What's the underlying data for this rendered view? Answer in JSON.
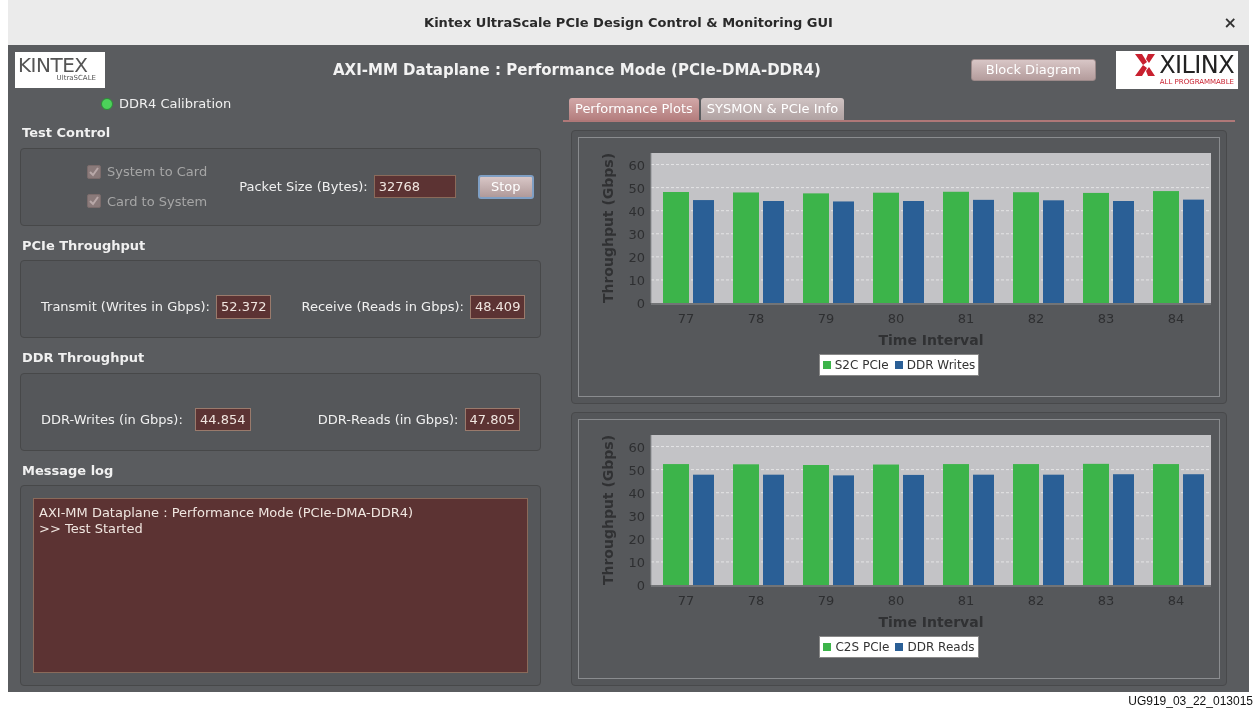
{
  "window": {
    "title": "Kintex UltraScale PCIe Design Control & Monitoring GUI",
    "close": "×"
  },
  "header": {
    "logo_left": {
      "main": "KINTEX",
      "sub": "UltraSCALE"
    },
    "title": "AXI-MM Dataplane : Performance Mode (PCIe-DMA-DDR4)",
    "button": "Block Diagram",
    "logo_right": {
      "main": "XILINX",
      "sub": "ALL PROGRAMMABLE"
    }
  },
  "status_led": {
    "label": "DDR4 Calibration",
    "on": true
  },
  "test_control": {
    "title": "Test Control",
    "checkboxes": [
      {
        "label": "System to Card",
        "checked": true,
        "disabled": true
      },
      {
        "label": "Card to System",
        "checked": true,
        "disabled": true
      }
    ],
    "packet_size": {
      "label": "Packet Size (Bytes):",
      "value": "32768"
    },
    "button": "Stop"
  },
  "pcie_throughput": {
    "title": "PCIe Throughput",
    "fields": [
      {
        "label": "Transmit (Writes in Gbps):",
        "value": "52.372"
      },
      {
        "label": "Receive (Reads in Gbps):",
        "value": "48.409"
      }
    ]
  },
  "ddr_throughput": {
    "title": "DDR Throughput",
    "fields": [
      {
        "label": "DDR-Writes (in Gbps):",
        "value": "44.854"
      },
      {
        "label": "DDR-Reads (in Gbps):",
        "value": "47.805"
      }
    ]
  },
  "message_log": {
    "title": "Message log",
    "lines": [
      "AXI-MM Dataplane : Performance Mode (PCIe-DMA-DDR4)",
      ">> Test Started"
    ]
  },
  "tabs": [
    {
      "label": "Performance Plots",
      "selected": true
    },
    {
      "label": "SYSMON & PCIe Info",
      "selected": false
    }
  ],
  "charts": [
    {
      "chart_data": {
        "type": "bar",
        "xlabel": "Time Interval",
        "ylabel": "Throughput (Gbps)",
        "categories": [
          "77",
          "78",
          "79",
          "80",
          "81",
          "82",
          "83",
          "84"
        ],
        "ylim": [
          0,
          65
        ],
        "yticks": [
          0,
          10,
          20,
          30,
          40,
          50,
          60
        ],
        "grid": true,
        "legend": true,
        "series": [
          {
            "name": "S2C PCIe",
            "color": "#3cb44a",
            "values": [
              48.1,
              47.9,
              47.5,
              47.8,
              48.2,
              48.0,
              47.7,
              48.5
            ]
          },
          {
            "name": "DDR Writes",
            "color": "#2a5f96",
            "values": [
              44.6,
              44.2,
              44.0,
              44.2,
              44.7,
              44.5,
              44.2,
              44.8
            ]
          }
        ]
      }
    },
    {
      "chart_data": {
        "type": "bar",
        "xlabel": "Time Interval",
        "ylabel": "Throughput (Gbps)",
        "categories": [
          "77",
          "78",
          "79",
          "80",
          "81",
          "82",
          "83",
          "84"
        ],
        "ylim": [
          0,
          65
        ],
        "yticks": [
          0,
          10,
          20,
          30,
          40,
          50,
          60
        ],
        "grid": true,
        "legend": true,
        "series": [
          {
            "name": "C2S PCIe",
            "color": "#3cb44a",
            "values": [
              52.4,
              52.3,
              52.0,
              52.2,
              52.4,
              52.4,
              52.5,
              52.4
            ]
          },
          {
            "name": "DDR Reads",
            "color": "#2a5f96",
            "values": [
              47.8,
              47.8,
              47.5,
              47.7,
              47.8,
              47.8,
              48.0,
              48.0
            ]
          }
        ]
      }
    }
  ],
  "figure_caption": "UG919_03_22_013015"
}
